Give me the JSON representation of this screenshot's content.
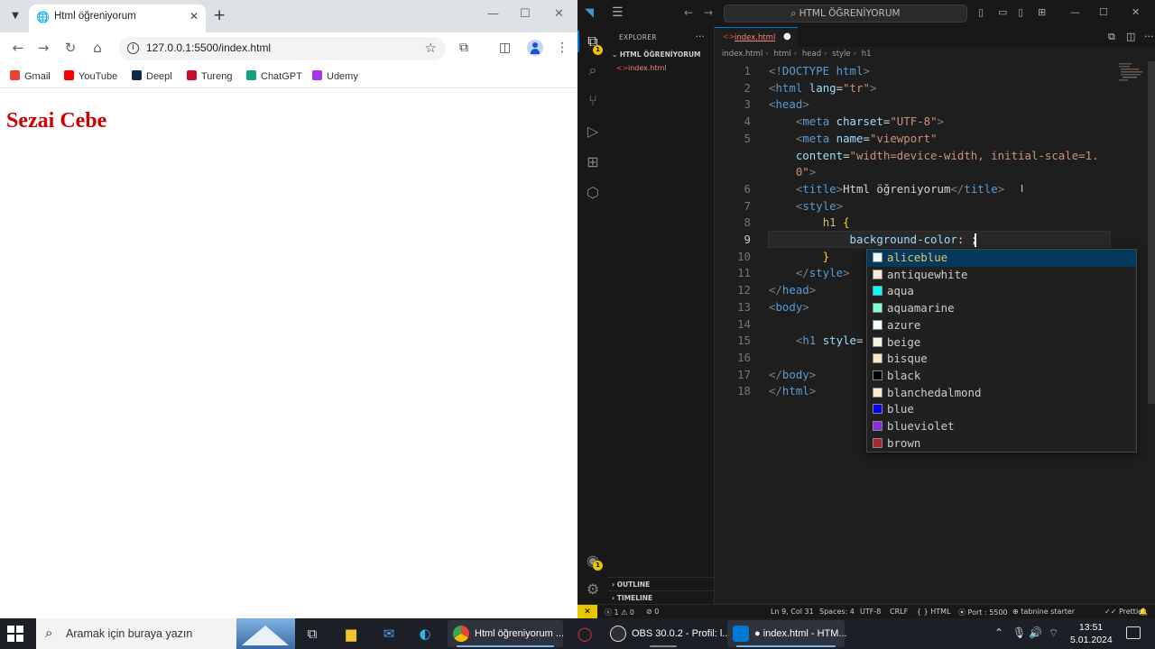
{
  "browser": {
    "tab_title": "Html öğreniyorum",
    "tab_close": "✕",
    "new_tab": "+",
    "url": "127.0.0.1:5500/index.html",
    "bookmarks": [
      {
        "label": "Gmail",
        "color": "#ea4335"
      },
      {
        "label": "YouTube",
        "color": "#ff0000"
      },
      {
        "label": "Deepl",
        "color": "#0f2b46"
      },
      {
        "label": "Tureng",
        "color": "#c8102e"
      },
      {
        "label": "ChatGPT",
        "color": "#10a37f"
      },
      {
        "label": "Udemy",
        "color": "#a435f0"
      }
    ],
    "page_heading": "Sezai Cebe",
    "heading_color": "#cc0000"
  },
  "vscode": {
    "command_center": "HTML ÖĞRENİYORUM",
    "explorer_title": "EXPLORER",
    "folder_name": "HTML ÖĞRENİYORUM",
    "file_name": "index.html",
    "tab_label": "index.html",
    "breadcrumb": [
      "index.html",
      "html",
      "head",
      "style",
      "h1"
    ],
    "outline_label": "OUTLINE",
    "timeline_label": "TIMELINE",
    "accent_color": "#0078d4",
    "code_lines": [
      {
        "n": "1",
        "parts": [
          [
            "br",
            "<!"
          ],
          [
            "tag",
            "DOCTYPE"
          ],
          [
            "tag",
            " html"
          ],
          [
            "br",
            ">"
          ]
        ]
      },
      {
        "n": "2",
        "parts": [
          [
            "br",
            "<"
          ],
          [
            "tag",
            "html"
          ],
          [
            "attr",
            " lang"
          ],
          [
            "txt",
            "="
          ],
          [
            "str",
            "\"tr\""
          ],
          [
            "br",
            ">"
          ]
        ]
      },
      {
        "n": "3",
        "parts": [
          [
            "br",
            "<"
          ],
          [
            "tag",
            "head"
          ],
          [
            "br",
            ">"
          ]
        ]
      },
      {
        "n": "4",
        "parts": [
          [
            "txt",
            "    "
          ],
          [
            "br",
            "<"
          ],
          [
            "tag",
            "meta"
          ],
          [
            "attr",
            " charset"
          ],
          [
            "txt",
            "="
          ],
          [
            "str",
            "\"UTF-8\""
          ],
          [
            "br",
            ">"
          ]
        ]
      },
      {
        "n": "5",
        "parts": [
          [
            "txt",
            "    "
          ],
          [
            "br",
            "<"
          ],
          [
            "tag",
            "meta"
          ],
          [
            "attr",
            " name"
          ],
          [
            "txt",
            "="
          ],
          [
            "str",
            "\"viewport\""
          ]
        ]
      },
      {
        "n": "",
        "parts": [
          [
            "txt",
            "    "
          ],
          [
            "attr",
            "content"
          ],
          [
            "txt",
            "="
          ],
          [
            "str",
            "\"width=device-width, initial-scale=1."
          ]
        ]
      },
      {
        "n": "",
        "parts": [
          [
            "txt",
            "    "
          ],
          [
            "str",
            "0\""
          ],
          [
            "br",
            ">"
          ]
        ]
      },
      {
        "n": "6",
        "parts": [
          [
            "txt",
            "    "
          ],
          [
            "br",
            "<"
          ],
          [
            "tag",
            "title"
          ],
          [
            "br",
            ">"
          ],
          [
            "txt",
            "Html öğreniyorum"
          ],
          [
            "br",
            "</"
          ],
          [
            "tag",
            "title"
          ],
          [
            "br",
            ">"
          ]
        ]
      },
      {
        "n": "7",
        "parts": [
          [
            "txt",
            "    "
          ],
          [
            "br",
            "<"
          ],
          [
            "tag",
            "style"
          ],
          [
            "br",
            ">"
          ]
        ]
      },
      {
        "n": "8",
        "parts": [
          [
            "txt",
            "        "
          ],
          [
            "sel",
            "h1"
          ],
          [
            "txt",
            " "
          ],
          [
            "brace",
            "{"
          ]
        ]
      },
      {
        "n": "9",
        "parts": [
          [
            "txt",
            "            "
          ],
          [
            "prop",
            "background-color"
          ],
          [
            "txt",
            ": "
          ],
          [
            "txt",
            ";"
          ]
        ]
      },
      {
        "n": "10",
        "parts": [
          [
            "txt",
            "        "
          ],
          [
            "brace",
            "}"
          ]
        ]
      },
      {
        "n": "11",
        "parts": [
          [
            "txt",
            "    "
          ],
          [
            "br",
            "</"
          ],
          [
            "tag",
            "style"
          ],
          [
            "br",
            ">"
          ]
        ]
      },
      {
        "n": "12",
        "parts": [
          [
            "br",
            "</"
          ],
          [
            "tag",
            "head"
          ],
          [
            "br",
            ">"
          ]
        ]
      },
      {
        "n": "13",
        "parts": [
          [
            "br",
            "<"
          ],
          [
            "tag",
            "body"
          ],
          [
            "br",
            ">"
          ]
        ]
      },
      {
        "n": "14",
        "parts": []
      },
      {
        "n": "15",
        "parts": [
          [
            "txt",
            "    "
          ],
          [
            "br",
            "<"
          ],
          [
            "tag",
            "h1"
          ],
          [
            "attr",
            " style"
          ],
          [
            "txt",
            "="
          ]
        ]
      },
      {
        "n": "16",
        "parts": []
      },
      {
        "n": "17",
        "parts": [
          [
            "br",
            "</"
          ],
          [
            "tag",
            "body"
          ],
          [
            "br",
            ">"
          ]
        ]
      },
      {
        "n": "18",
        "parts": [
          [
            "br",
            "</"
          ],
          [
            "tag",
            "html"
          ],
          [
            "br",
            ">"
          ]
        ]
      }
    ],
    "current_line": "9",
    "suggestions": [
      {
        "label": "aliceblue",
        "color": "#f0f8ff"
      },
      {
        "label": "antiquewhite",
        "color": "#faebd7"
      },
      {
        "label": "aqua",
        "color": "#00ffff"
      },
      {
        "label": "aquamarine",
        "color": "#7fffd4"
      },
      {
        "label": "azure",
        "color": "#f0ffff"
      },
      {
        "label": "beige",
        "color": "#f5f5dc"
      },
      {
        "label": "bisque",
        "color": "#ffe4c4"
      },
      {
        "label": "black",
        "color": "#000000"
      },
      {
        "label": "blanchedalmond",
        "color": "#ffebcd"
      },
      {
        "label": "blue",
        "color": "#0000ff"
      },
      {
        "label": "blueviolet",
        "color": "#8a2be2"
      },
      {
        "label": "brown",
        "color": "#a52a2a"
      }
    ],
    "selected_suggestion": "aliceblue",
    "status": {
      "errors": "1",
      "warnings": "0",
      "ports": "0",
      "position": "Ln 9, Col 31",
      "spaces": "Spaces: 4",
      "encoding": "UTF-8",
      "eol": "CRLF",
      "language": "HTML",
      "port": "Port : 5500",
      "tabnine": "tabnine starter",
      "prettier": "Prettier"
    },
    "activity_badge": "1"
  },
  "taskbar": {
    "search_placeholder": "Aramak için buraya yazın",
    "apps": [
      {
        "label": "Html öğreniyorum ...",
        "color": "#4285f4"
      },
      {
        "label": "OBS 30.0.2 - Profil: l...",
        "color": "#302e31"
      },
      {
        "label": "● index.html - HTM...",
        "color": "#0078d4"
      }
    ],
    "time": "13:51",
    "date": "5.01.2024"
  }
}
